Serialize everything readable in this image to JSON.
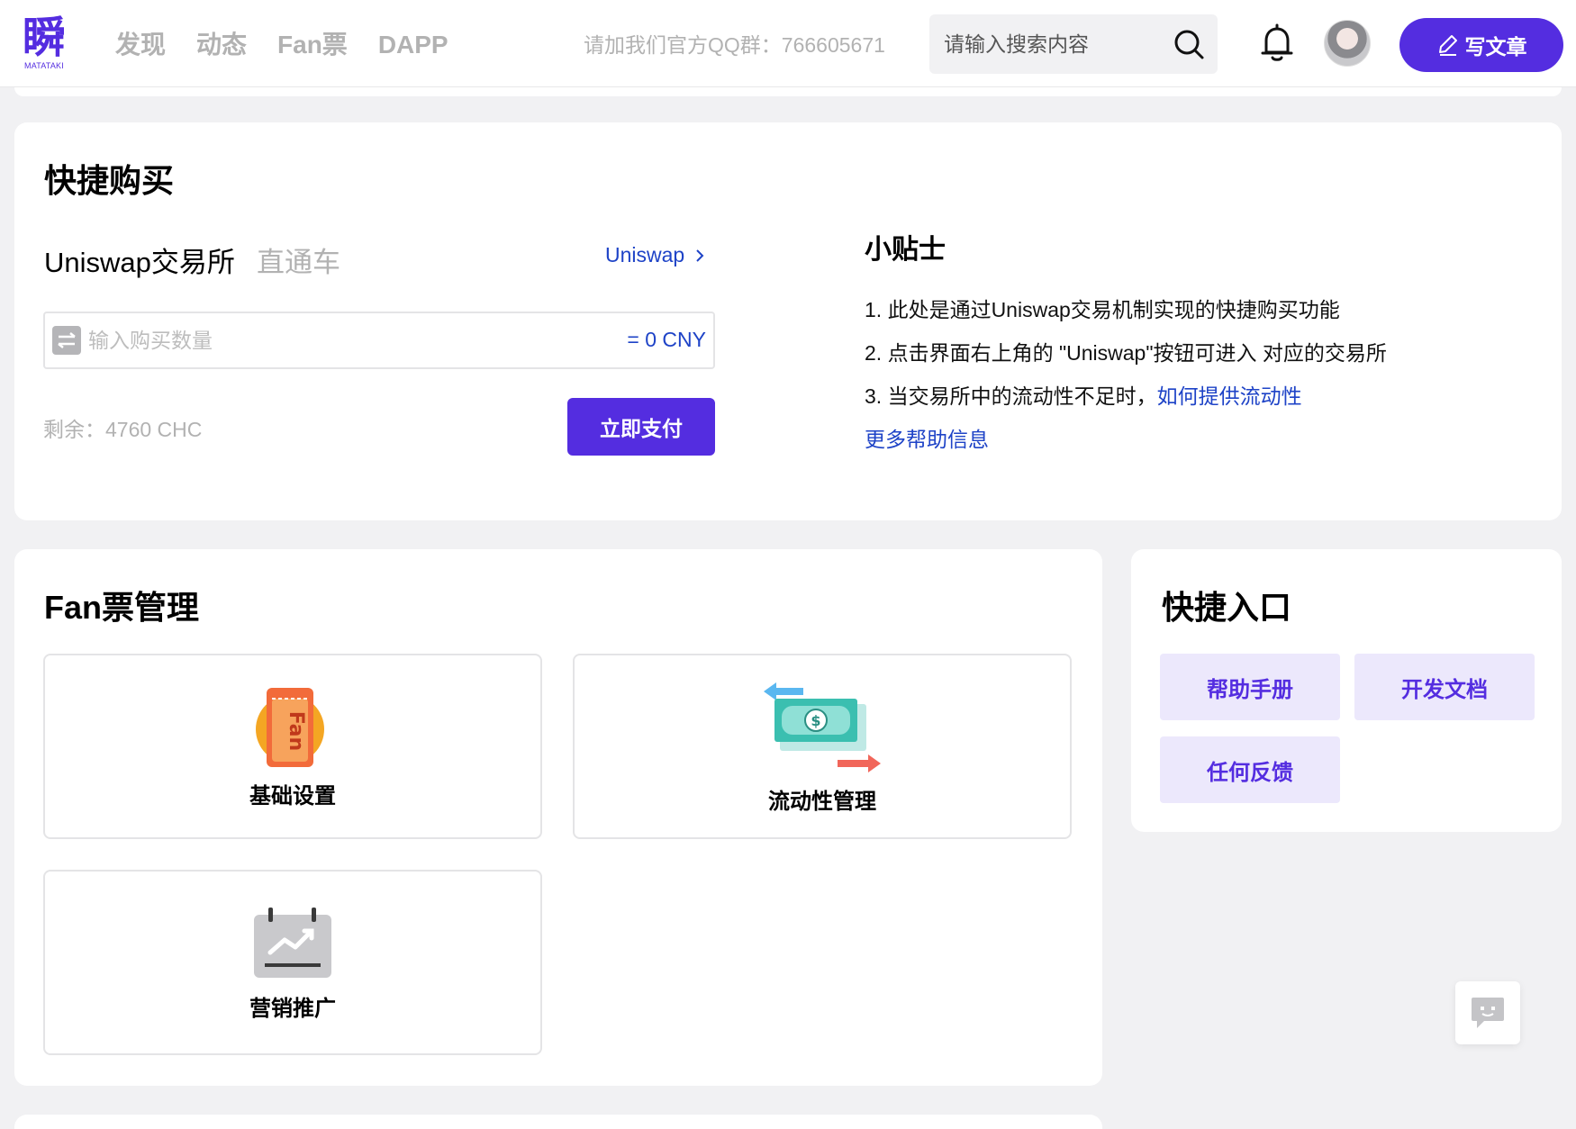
{
  "header": {
    "logo_glyph": "瞬",
    "logo_sub": "MATATAKI",
    "nav": [
      "发现",
      "动态",
      "Fan票",
      "DAPP"
    ],
    "qq_notice": "请加我们官方QQ群：766605671",
    "search_placeholder": "请输入搜索内容",
    "write_label": "写文章"
  },
  "quick_buy": {
    "title": "快捷购买",
    "exchange_title": "Uniswap交易所",
    "exchange_sub": "直通车",
    "uniswap_link": "Uniswap",
    "amount_placeholder": "输入购买数量",
    "cny_value": "= 0 CNY",
    "remaining": "剩余：4760 CHC",
    "pay_label": "立即支付",
    "tips": {
      "title": "小贴士",
      "tip1": "1. 此处是通过Uniswap交易机制实现的快捷购买功能",
      "tip2": "2. 点击界面右上角的 \"Uniswap\"按钮可进入 对应的交易所",
      "tip3_prefix": "3. 当交易所中的流动性不足时，",
      "tip3_link": "如何提供流动性",
      "more_help": "更多帮助信息"
    }
  },
  "fan_mgmt": {
    "title": "Fan票管理",
    "tiles": [
      {
        "label": "基础设置",
        "icon": "fan-ticket-icon"
      },
      {
        "label": "流动性管理",
        "icon": "money-exchange-icon"
      },
      {
        "label": "营销推广",
        "icon": "calendar-chart-icon"
      }
    ],
    "fan_icon_text": "Fan"
  },
  "quick_entry": {
    "title": "快捷入口",
    "buttons": [
      "帮助手册",
      "开发文档",
      "任何反馈"
    ]
  },
  "colors": {
    "brand": "#542de0",
    "link": "#1e43c7",
    "muted": "#b2b2b2"
  }
}
